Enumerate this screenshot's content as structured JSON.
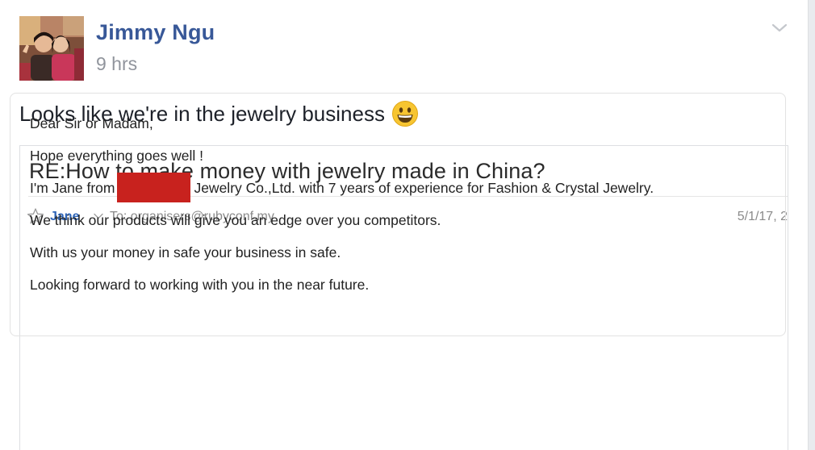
{
  "post": {
    "author": "Jimmy Ngu",
    "time": "9 hrs",
    "text": "Looks like we're in the jewelry business",
    "emoji": "grinning-face-icon"
  },
  "email": {
    "subject": "RE:How to make money with jewelry made in China?",
    "sender": "Jane",
    "to": "To: organisers@rubyconf.my",
    "date": "5/1/17, 2",
    "body": {
      "greeting": "Dear Sir or Madam,",
      "line1": "Hope everything goes well !",
      "line2_prefix": "I'm Jane from",
      "line2_suffix": "Jewelry Co.,Ltd. with 7 years of experience for Fashion & Crystal Jewelry.",
      "line3": "We think our products will give you an edge over you competitors.",
      "line4": "With us your money in safe your business in safe.",
      "line5": "Looking forward to working with you in the near future."
    }
  },
  "colors": {
    "author_link": "#385898",
    "sender_link": "#2f65b8",
    "redaction": "#c8221e",
    "muted": "#90949c"
  }
}
